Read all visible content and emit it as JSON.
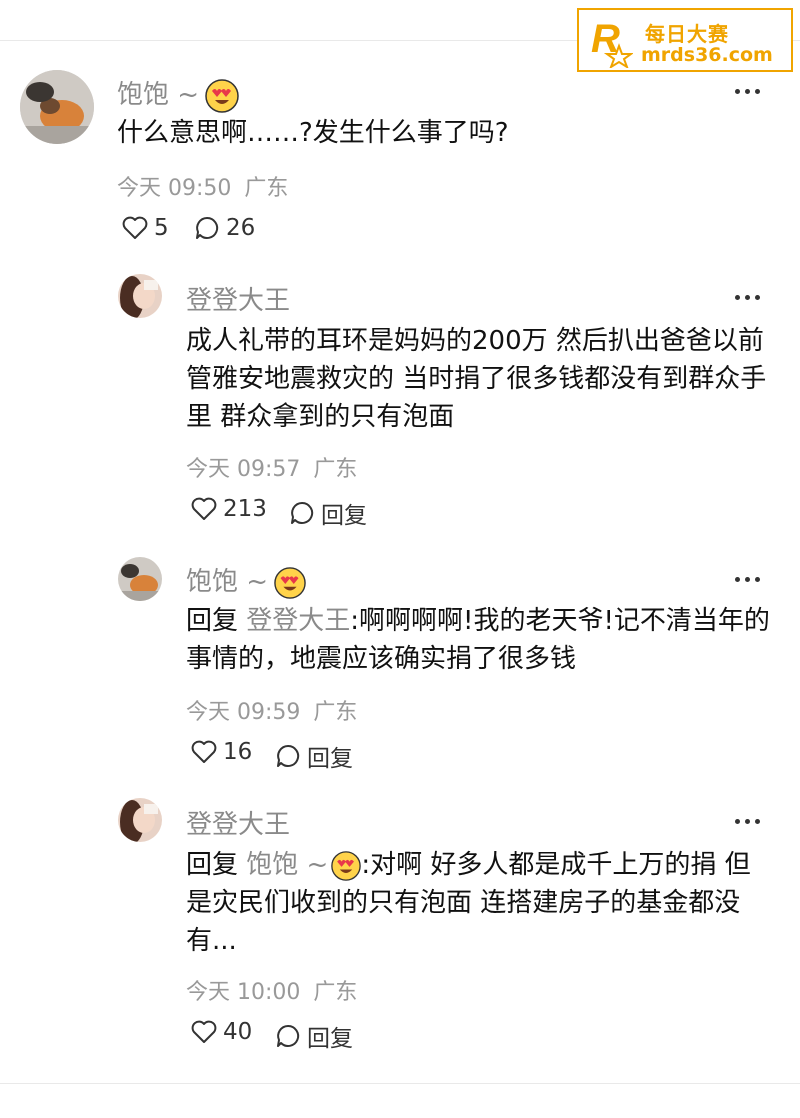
{
  "watermark": {
    "logo_letter": "R",
    "cn": "每日大赛",
    "url": "mrds36.com"
  },
  "comments": [
    {
      "name": "饱饱 ~",
      "has_emoji": true,
      "reply_label": "",
      "reply_to": "",
      "text": "什么意思啊……?发生什么事了吗?",
      "time": "今天 09:50",
      "location": "广东",
      "likes": "5",
      "replies": "26",
      "reply_action": ""
    },
    {
      "name": "登登大王",
      "has_emoji": false,
      "reply_label": "",
      "reply_to": "",
      "text": "成人礼带的耳环是妈妈的200万 然后扒出爸爸以前管雅安地震救灾的 当时捐了很多钱都没有到群众手里 群众拿到的只有泡面",
      "time": "今天 09:57",
      "location": "广东",
      "likes": "213",
      "replies": "",
      "reply_action": "回复"
    },
    {
      "name": "饱饱 ~",
      "has_emoji": true,
      "reply_label": "回复",
      "reply_to": "登登大王",
      "text": ":啊啊啊啊!我的老天爷!记不清当年的事情的，地震应该确实捐了很多钱",
      "time": "今天 09:59",
      "location": "广东",
      "likes": "16",
      "replies": "",
      "reply_action": "回复"
    },
    {
      "name": "登登大王",
      "has_emoji": false,
      "reply_label": "回复",
      "reply_to": "饱饱 ~",
      "text": ":对啊 好多人都是成千上万的捐 但是灾民们收到的只有泡面 连搭建房子的基金都没有...",
      "time": "今天 10:00",
      "location": "广东",
      "likes": "40",
      "replies": "",
      "reply_action": "回复"
    }
  ]
}
